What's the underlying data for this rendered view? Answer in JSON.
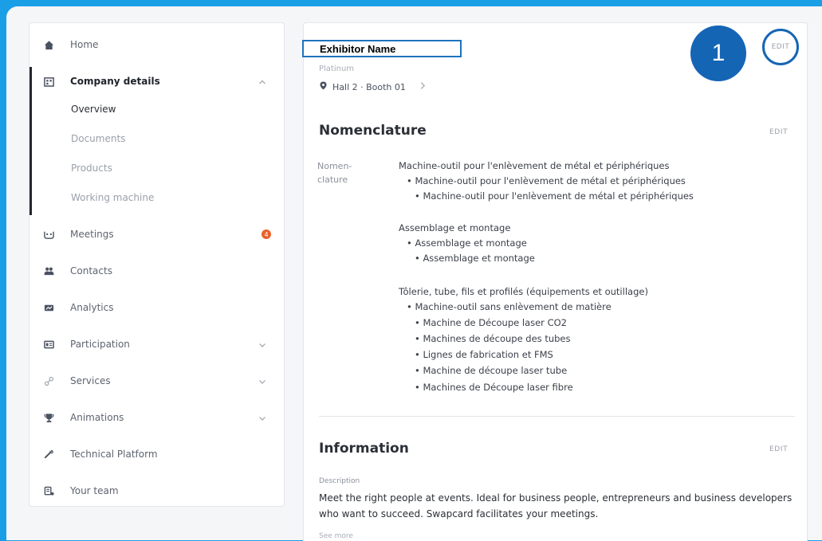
{
  "sidebar": {
    "items": [
      {
        "label": "Home",
        "icon": "home-icon"
      },
      {
        "label": "Company details",
        "icon": "company-icon",
        "expanded": true
      },
      {
        "label": "Meetings",
        "icon": "meetings-icon",
        "badge": "4"
      },
      {
        "label": "Contacts",
        "icon": "contacts-icon"
      },
      {
        "label": "Analytics",
        "icon": "analytics-icon"
      },
      {
        "label": "Participation",
        "icon": "participation-icon"
      },
      {
        "label": "Services",
        "icon": "services-icon"
      },
      {
        "label": "Animations",
        "icon": "trophy-icon"
      },
      {
        "label": "Technical Platform",
        "icon": "wrench-icon"
      },
      {
        "label": "Your team",
        "icon": "team-icon"
      }
    ],
    "subitems": [
      "Overview",
      "Documents",
      "Products",
      "Working machine"
    ]
  },
  "header": {
    "exhibitor_name": "Exhibitor Name",
    "tier": "Platinum",
    "booth": "Hall 2 · Booth 01",
    "edit_label": "EDIT",
    "step_number": "1"
  },
  "nomenclature": {
    "title": "Nomenclature",
    "edit_label": "EDIT",
    "field_label_1": "Nomen-",
    "field_label_2": "clature",
    "lines": [
      "Machine-outil pour l'enlèvement de métal et périphériques",
      "• Machine-outil pour l'enlèvement de métal et périphériques",
      "• Machine-outil pour l'enlèvement de métal et périphériques",
      "Assemblage et montage",
      "• Assemblage et montage",
      "• Assemblage et montage",
      "Tôlerie, tube, fils et profilés (équipements et outillage)",
      "• Machine-outil sans enlèvement de matière",
      "• Machine de Découpe laser CO2",
      "• Machines de découpe des tubes",
      "• Lignes de fabrication et FMS",
      "• Machine de découpe laser tube",
      "• Machines de Découpe laser fibre"
    ]
  },
  "information": {
    "title": "Information",
    "edit_label": "EDIT",
    "description_label": "Description",
    "description": "Meet the right people at events. Ideal for business people, entrepreneurs and business developers who want to succeed. Swapcard facilitates your meetings.",
    "see_more": "See more"
  },
  "colors": {
    "background": "#1a9ee6",
    "highlight": "#1565b5",
    "badge": "#e8622a"
  }
}
